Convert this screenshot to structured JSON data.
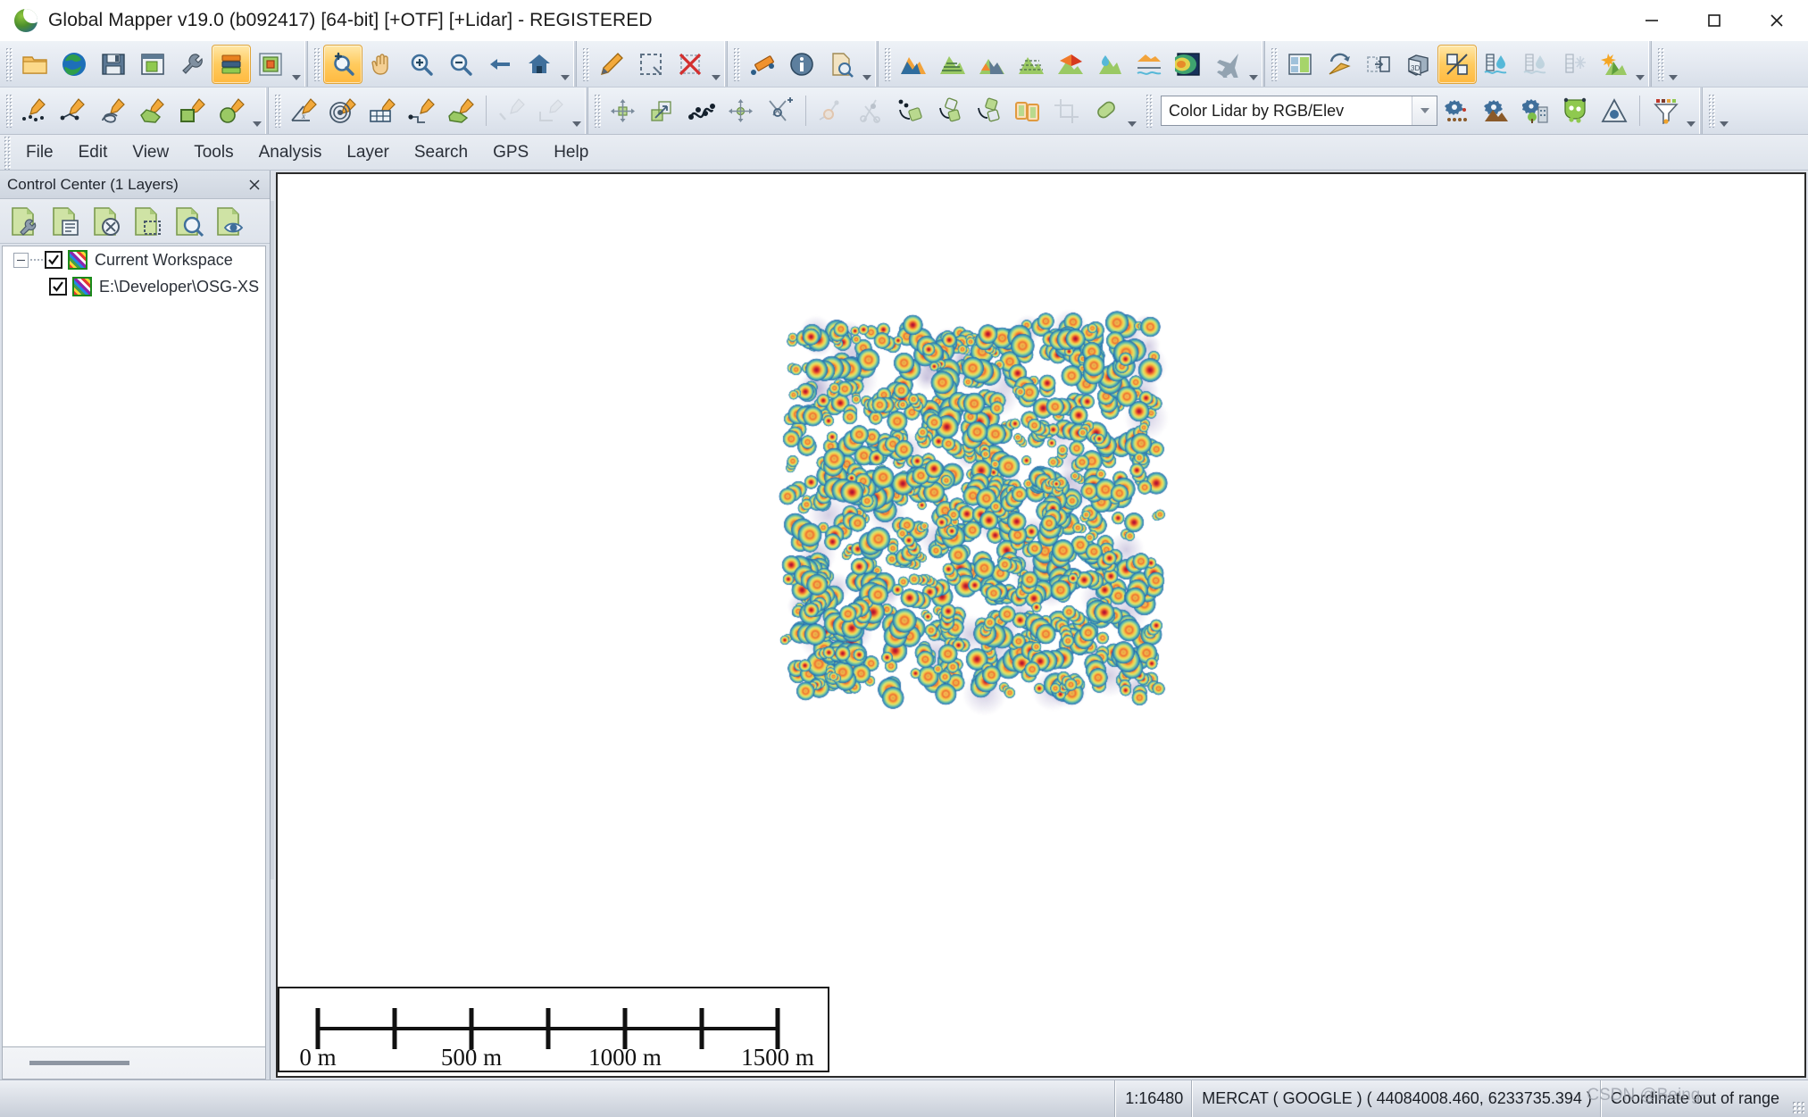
{
  "window": {
    "title": "Global Mapper v19.0 (b092417) [64-bit] [+OTF] [+Lidar] - REGISTERED",
    "logo_name": "global-mapper-logo",
    "controls": [
      {
        "name": "minimize-button",
        "glyph": "minimize"
      },
      {
        "name": "maximize-button",
        "glyph": "maximize"
      },
      {
        "name": "close-button",
        "glyph": "close"
      }
    ]
  },
  "toolbars": {
    "row1": [
      {
        "group": "file-toolbar",
        "buttons": [
          {
            "name": "open-data-file-icon",
            "icon": "folder",
            "active": false
          },
          {
            "name": "open-online-data-icon",
            "icon": "globe",
            "active": false
          },
          {
            "name": "save-workspace-icon",
            "icon": "floppy",
            "active": false
          },
          {
            "name": "open-new-window-icon",
            "icon": "window",
            "active": false
          },
          {
            "name": "configure-icon",
            "icon": "wrench",
            "active": false
          },
          {
            "name": "open-control-center-icon",
            "icon": "books",
            "active": true
          },
          {
            "name": "overlay-layers-icon",
            "icon": "layers",
            "active": false
          }
        ]
      },
      {
        "group": "navigation-toolbar",
        "buttons": [
          {
            "name": "zoom-select-tool-icon",
            "icon": "zoom-select",
            "active": true
          },
          {
            "name": "pan-tool-icon",
            "icon": "hand",
            "active": false
          },
          {
            "name": "zoom-in-icon",
            "icon": "zoom-in",
            "active": false
          },
          {
            "name": "zoom-out-icon",
            "icon": "zoom-out",
            "active": false
          },
          {
            "name": "previous-view-icon",
            "icon": "back-arrow",
            "active": false
          },
          {
            "name": "full-view-icon",
            "icon": "home",
            "active": false
          }
        ]
      },
      {
        "group": "digitizer-toolbar",
        "buttons": [
          {
            "name": "digitizer-tool-icon",
            "icon": "pencil",
            "active": false
          },
          {
            "name": "feature-selection-icon",
            "icon": "marquee",
            "active": false
          },
          {
            "name": "delete-feature-icon",
            "icon": "red-x",
            "active": false
          }
        ]
      },
      {
        "group": "measure-toolbar",
        "buttons": [
          {
            "name": "measure-tool-icon",
            "icon": "ruler",
            "active": false
          },
          {
            "name": "feature-info-icon",
            "icon": "info",
            "active": false
          },
          {
            "name": "search-features-icon",
            "icon": "doc-search",
            "active": false
          }
        ]
      },
      {
        "group": "analysis-toolbar",
        "buttons": [
          {
            "name": "terrain-profile-icon",
            "icon": "mtn-profile",
            "active": false
          },
          {
            "name": "contour-generation-icon",
            "icon": "mtn-contour",
            "active": false
          },
          {
            "name": "watershed-icon",
            "icon": "mtn-orange",
            "active": false
          },
          {
            "name": "view-shed-icon",
            "icon": "mtn-dashed",
            "active": false
          },
          {
            "name": "line-of-sight-icon",
            "icon": "mtn-cone",
            "active": false
          },
          {
            "name": "water-level-icon",
            "icon": "mtn-water",
            "active": false
          },
          {
            "name": "terrain-paint-icon",
            "icon": "mtn-layers",
            "active": false
          },
          {
            "name": "elevation-legend-icon",
            "icon": "gradient-box",
            "active": false
          },
          {
            "name": "flight-path-icon",
            "icon": "plane",
            "active": false
          }
        ]
      },
      {
        "group": "view-toolbar",
        "buttons": [
          {
            "name": "map-layout-icon",
            "icon": "layout",
            "active": false
          },
          {
            "name": "path-profile-icon",
            "icon": "arrow-path",
            "active": false
          },
          {
            "name": "split-view-icon",
            "icon": "split",
            "active": false
          },
          {
            "name": "3d-view-icon",
            "icon": "cube-3d",
            "active": false
          },
          {
            "name": "compare-layers-icon",
            "icon": "percent",
            "active": true
          },
          {
            "name": "water-gauge-1-icon",
            "icon": "gauge-water",
            "active": false
          },
          {
            "name": "water-gauge-2-icon",
            "icon": "gauge-water-off",
            "active": false
          },
          {
            "name": "water-gauge-3-icon",
            "icon": "gauge-snow-off",
            "active": false
          },
          {
            "name": "sun-shadow-icon",
            "icon": "sun-mtn",
            "active": false
          }
        ]
      }
    ],
    "row2": [
      {
        "group": "create-feature-toolbar",
        "buttons": [
          {
            "name": "digitize-point-icon",
            "icon": "pen-points",
            "active": false
          },
          {
            "name": "digitize-line-icon",
            "icon": "pen-line",
            "active": false
          },
          {
            "name": "digitize-freehand-icon",
            "icon": "pen-loop",
            "active": false
          },
          {
            "name": "digitize-area-icon",
            "icon": "pen-area",
            "active": false
          },
          {
            "name": "digitize-rectangle-icon",
            "icon": "pen-rect",
            "active": false
          },
          {
            "name": "digitize-circle-icon",
            "icon": "pen-circle",
            "active": false
          }
        ]
      },
      {
        "group": "advanced-create-toolbar",
        "buttons": [
          {
            "name": "digitize-by-angle-icon",
            "icon": "pen-angle",
            "active": false
          },
          {
            "name": "digitize-range-ring-icon",
            "icon": "pen-target",
            "active": false
          },
          {
            "name": "digitize-grid-icon",
            "icon": "pen-grid",
            "active": false
          },
          {
            "name": "digitize-node-icon",
            "icon": "pen-node",
            "active": false
          },
          {
            "name": "digitize-shape-icon",
            "icon": "pen-shape",
            "active": false
          },
          {
            "name": "accept-edit-icon",
            "icon": "pen-check",
            "active": false,
            "disabled": true
          },
          {
            "name": "corner-edit-icon",
            "icon": "pen-corner",
            "active": false,
            "disabled": true
          }
        ]
      },
      {
        "group": "edit-feature-toolbar",
        "buttons": [
          {
            "name": "move-feature-icon",
            "icon": "move",
            "active": false
          },
          {
            "name": "scale-rotate-icon",
            "icon": "scale-rotate",
            "active": false
          },
          {
            "name": "reshape-icon",
            "icon": "reshape",
            "active": false
          },
          {
            "name": "move-vertex-icon",
            "icon": "move-vertex",
            "active": false
          },
          {
            "name": "snap-vertex-icon",
            "icon": "snap",
            "active": false
          },
          {
            "name": "add-vertex-icon",
            "icon": "add-vertex",
            "active": false,
            "disabled": true
          },
          {
            "name": "split-feature-icon",
            "icon": "scissors",
            "active": false,
            "disabled": true
          },
          {
            "name": "copy-rotate-icon",
            "icon": "copy-rotate-1",
            "active": false
          },
          {
            "name": "duplicate-area-icon",
            "icon": "copy-rotate-2",
            "active": false
          },
          {
            "name": "mirror-area-icon",
            "icon": "copy-rotate-3",
            "active": false
          },
          {
            "name": "combine-areas-icon",
            "icon": "combine",
            "active": false
          },
          {
            "name": "crop-icon",
            "icon": "crop",
            "active": false,
            "disabled": true
          },
          {
            "name": "measure-length-icon",
            "icon": "capsule",
            "active": false
          }
        ]
      }
    ],
    "lidar_combo": {
      "name": "lidar-draw-mode-combo",
      "value": "Color Lidar by RGB/Elev"
    },
    "lidar_buttons": [
      {
        "name": "lidar-classify-icon",
        "icon": "gear-points",
        "active": false
      },
      {
        "name": "lidar-ground-icon",
        "icon": "gear-mtn",
        "active": false
      },
      {
        "name": "lidar-buildings-icon",
        "icon": "gear-building",
        "active": false
      },
      {
        "name": "lidar-extract-icon",
        "icon": "extract-green",
        "active": false
      },
      {
        "name": "lidar-qc-icon",
        "icon": "triangle-blue",
        "active": false
      },
      {
        "name": "lidar-filter-icon",
        "icon": "funnel",
        "active": false
      }
    ]
  },
  "menubar": {
    "items": [
      {
        "name": "menu-file",
        "label": "File"
      },
      {
        "name": "menu-edit",
        "label": "Edit"
      },
      {
        "name": "menu-view",
        "label": "View"
      },
      {
        "name": "menu-tools",
        "label": "Tools"
      },
      {
        "name": "menu-analysis",
        "label": "Analysis"
      },
      {
        "name": "menu-layer",
        "label": "Layer"
      },
      {
        "name": "menu-search",
        "label": "Search"
      },
      {
        "name": "menu-gps",
        "label": "GPS"
      },
      {
        "name": "menu-help",
        "label": "Help"
      }
    ]
  },
  "control_center": {
    "title": "Control Center (1 Layers)",
    "close_label": "×",
    "tools": [
      {
        "name": "layer-options-icon",
        "icon": "layer-wrench"
      },
      {
        "name": "layer-metadata-icon",
        "icon": "layer-list"
      },
      {
        "name": "close-layer-icon",
        "icon": "layer-close"
      },
      {
        "name": "layer-bounds-icon",
        "icon": "layer-bounds"
      },
      {
        "name": "zoom-to-layer-icon",
        "icon": "layer-zoom"
      },
      {
        "name": "toggle-layer-visibility-icon",
        "icon": "layer-eye"
      }
    ],
    "tree": [
      {
        "name": "tree-item-workspace",
        "label": "Current Workspace",
        "checked": true,
        "level": 0,
        "expanded": true
      },
      {
        "name": "tree-item-layer",
        "label": "E:\\Developer\\OSG-XS",
        "checked": true,
        "level": 1,
        "expanded": false
      }
    ]
  },
  "map": {
    "scalebar": {
      "name": "map-scale-bar",
      "labels": [
        "0 m",
        "500 m",
        "1000 m",
        "1500 m"
      ],
      "tick_count": 7
    },
    "point_cloud": {
      "name": "lidar-point-cloud",
      "colors": [
        "#5b2b8a",
        "#2a5fa8",
        "#2e9fb5",
        "#7fc79a",
        "#d9e36b",
        "#f6c344",
        "#ef7b3a",
        "#c3123c"
      ],
      "blob_count": 620,
      "seed": 20240917
    }
  },
  "statusbar": {
    "scale": "1:16480",
    "projection": "MERCAT ( GOOGLE ) ( 44084008.460, 6233735.394 )",
    "message": "Coordinate out of range",
    "watermark": "CSDN @Being--"
  }
}
